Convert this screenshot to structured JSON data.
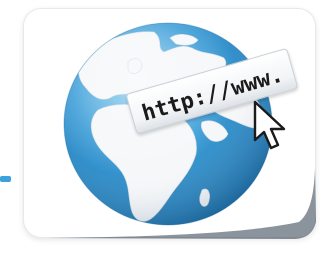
{
  "illustration": {
    "subject": "globe-with-address-bar",
    "address_text": "http://www.",
    "icon": "mouse-pointer-icon",
    "colors": {
      "ocean": "#3e9ed8",
      "land": "#f5f7f9",
      "accent": "#3da2dc",
      "text": "#1b1b1b"
    }
  }
}
